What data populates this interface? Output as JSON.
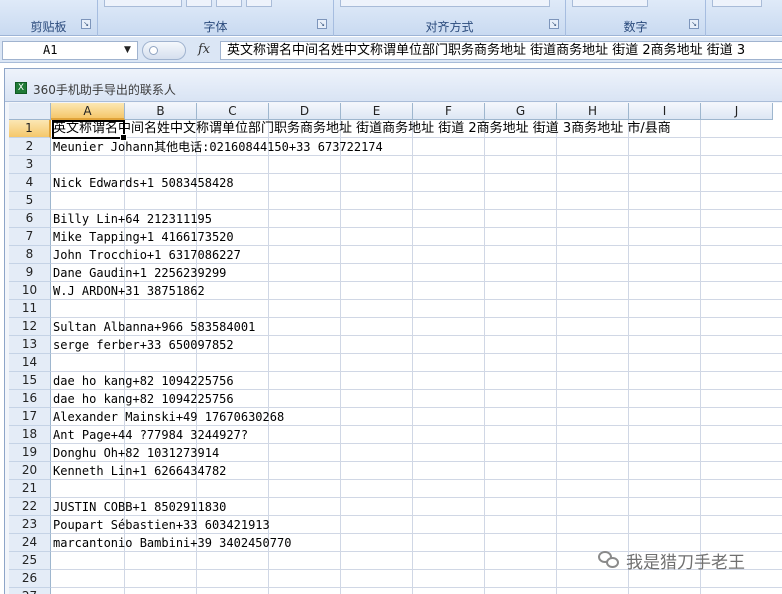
{
  "ribbon": {
    "groups": [
      {
        "label": "剪贴板"
      },
      {
        "label": "字体"
      },
      {
        "label": "对齐方式"
      },
      {
        "label": "数字"
      },
      {
        "label": ""
      }
    ]
  },
  "formula_bar": {
    "name_box": "A1",
    "fx_label": "fx",
    "value": "英文称谓名中间名姓中文称谓单位部门职务商务地址 街道商务地址 街道 2商务地址 街道 3"
  },
  "workbook": {
    "title": "360手机助手导出的联系人",
    "icon_label": "X"
  },
  "sheet": {
    "active_cell": "A1",
    "columns": [
      "A",
      "B",
      "C",
      "D",
      "E",
      "F",
      "G",
      "H",
      "I",
      "J"
    ],
    "rows": [
      {
        "num": "1",
        "text": "英文称谓名中间名姓中文称谓单位部门职务商务地址 街道商务地址 街道 2商务地址 街道 3商务地址 市/县商"
      },
      {
        "num": "2",
        "text": "Meunier Johann其他电话:02160844150+33 673722174"
      },
      {
        "num": "3",
        "text": ""
      },
      {
        "num": "4",
        "text": "Nick Edwards+1 5083458428"
      },
      {
        "num": "5",
        "text": ""
      },
      {
        "num": "6",
        "text": "Billy Lin+64 212311195"
      },
      {
        "num": "7",
        "text": "Mike Tapping+1 4166173520"
      },
      {
        "num": "8",
        "text": "John Trocchio+1 6317086227"
      },
      {
        "num": "9",
        "text": "Dane Gaudin+1 2256239299"
      },
      {
        "num": "10",
        "text": "W.J ARDON+31 38751862"
      },
      {
        "num": "11",
        "text": ""
      },
      {
        "num": "12",
        "text": "Sultan Albanna+966 583584001"
      },
      {
        "num": "13",
        "text": "serge ferber+33 650097852"
      },
      {
        "num": "14",
        "text": ""
      },
      {
        "num": "15",
        "text": "dae ho kang+82 1094225756"
      },
      {
        "num": "16",
        "text": "dae ho kang+82 1094225756"
      },
      {
        "num": "17",
        "text": "Alexander Mainski+49 17670630268"
      },
      {
        "num": "18",
        "text": "Ant Page+44 ?77984 3244927?"
      },
      {
        "num": "19",
        "text": "Donghu Oh+82 1031273914"
      },
      {
        "num": "20",
        "text": "Kenneth Lin+1 6266434782"
      },
      {
        "num": "21",
        "text": ""
      },
      {
        "num": "22",
        "text": "JUSTIN COBB+1 8502911830"
      },
      {
        "num": "23",
        "text": "Poupart Sébastien+33 603421913"
      },
      {
        "num": "24",
        "text": "marcantonio Bambini+39 3402450770"
      },
      {
        "num": "25",
        "text": ""
      },
      {
        "num": "26",
        "text": ""
      },
      {
        "num": "27",
        "text": ""
      }
    ]
  },
  "watermark": {
    "text": "我是猎刀手老王"
  },
  "colors": {
    "ribbon_bg": "#c9daf1",
    "header_bg": "#e4ecf7",
    "active_header": "#f5c76b",
    "gridline": "#d0d7e5",
    "excel_green": "#1f7a36"
  }
}
